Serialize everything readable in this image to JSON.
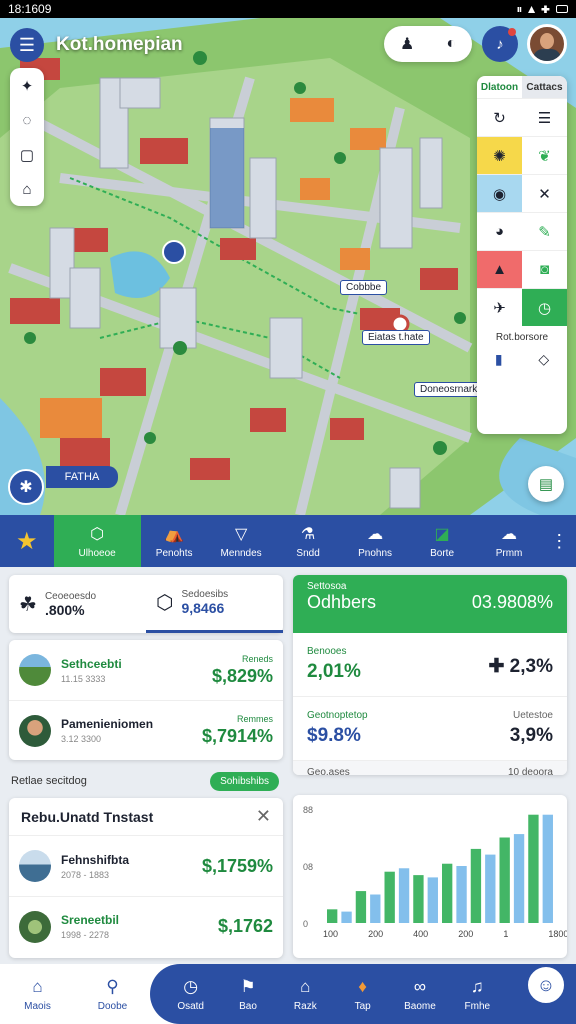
{
  "status_bar": {
    "time": "18:1609",
    "icons": "⏸ ▲ ✚"
  },
  "map": {
    "title": "Kot.homepian",
    "label_left": "FATHA",
    "poi_labels": [
      "Cobbbe",
      "Eiatas t.hate",
      "Doneosrnarke"
    ],
    "panel": {
      "header": [
        "Dlatoon",
        "Cattacs"
      ],
      "footer_label": "Rot.borsore"
    }
  },
  "tab_bar": {
    "tabs": [
      {
        "label": "",
        "icon": "star-icon"
      },
      {
        "label": "Ulhoeoe",
        "icon": "hexagon-icon"
      },
      {
        "label": "Penohts",
        "icon": "tent-icon"
      },
      {
        "label": "Menndes",
        "icon": "triangle-icon"
      },
      {
        "label": "Sndd",
        "icon": "flask-icon"
      },
      {
        "label": "Pnohns",
        "icon": "cloud-icon"
      },
      {
        "label": "Borte",
        "icon": "chat-icon"
      },
      {
        "label": "Prmm",
        "icon": "cloud2-icon"
      }
    ]
  },
  "summary_tabs": [
    {
      "label": "Ceoeoesdo",
      "value": ".800%"
    },
    {
      "label": "Sedoesibs",
      "value": "9,8466"
    }
  ],
  "list1": [
    {
      "name": "Sethceebti",
      "sub": "11.15 3333",
      "tag": "Reneds",
      "price": "$,829%"
    },
    {
      "name": "Pamenieniomen",
      "sub": "3.12 3300",
      "tag": "Remmes",
      "price": "$,7914%"
    }
  ],
  "section": {
    "label": "Retlae secitdog",
    "button": "Sohibshibs"
  },
  "list2": {
    "title": "Rebu.Unatd Tnstast",
    "rows": [
      {
        "name": "Fehnshifbta",
        "sub": "2078 - 1883",
        "price": "$,1759%"
      },
      {
        "name": "Sreneetbil",
        "sub": "1998 - 2278",
        "price": "$,1762"
      }
    ]
  },
  "stats": {
    "head_small": "Settosoa",
    "head_title": "Odhbers",
    "head_value": "03.9808%",
    "cells": [
      {
        "label": "Benooes",
        "value": "2,01%"
      },
      {
        "label": "",
        "value": "✚ 2,3%"
      },
      {
        "label": "Geotnoptetop",
        "value": "$9.8%"
      },
      {
        "label": "Uetestoe",
        "value": "3,9%"
      }
    ],
    "foot_left": "Geo.ases",
    "foot_right": "10 deoora"
  },
  "chart_data": {
    "type": "bar",
    "categories": [
      "100",
      "200",
      "400",
      "200",
      "1",
      "1800"
    ],
    "series": [
      {
        "values": [
          12,
          10,
          28,
          25,
          45,
          48,
          42,
          40,
          52,
          50,
          65,
          60,
          75,
          78,
          95,
          95
        ]
      }
    ],
    "ytick_labels": [
      "88",
      "08",
      "0"
    ],
    "xtick_labels": [
      "100",
      "200",
      "400",
      "200",
      "1",
      "1800"
    ],
    "colors": [
      "#2fae55",
      "#5aa9e6"
    ]
  },
  "bottom_nav": {
    "left": [
      {
        "label": "Maois",
        "icon": "home-icon"
      },
      {
        "label": "Doobe",
        "icon": "search-icon"
      }
    ],
    "pill": [
      {
        "label": "Osatd",
        "icon": "clock-icon"
      },
      {
        "label": "Bao",
        "icon": "flag-icon"
      },
      {
        "label": "Razk",
        "icon": "house-icon"
      },
      {
        "label": "Tap",
        "icon": "pin-icon"
      },
      {
        "label": "Baome",
        "icon": "link-icon"
      },
      {
        "label": "Fmhe",
        "icon": "bell-icon"
      }
    ]
  }
}
